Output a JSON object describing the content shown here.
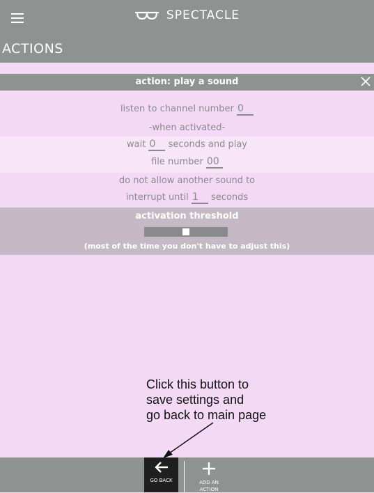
{
  "header": {
    "app_title": "SPECTACLE",
    "menu_icon": "hamburger-menu-icon",
    "logo_icon": "spectacles-logo-icon"
  },
  "section_title": "ACTIONS",
  "action": {
    "title": "action: play a sound",
    "close_icon": "close-icon",
    "channel_label": "listen to channel number",
    "channel_value": "0",
    "when_activated": "-when activated-",
    "wait_label": "wait",
    "wait_value": "0",
    "seconds_and_play": "seconds and play",
    "file_label": "file number",
    "file_value": "00",
    "no_interrupt_line1": "do not allow another sound to",
    "interrupt_until": "interrupt until",
    "interrupt_value": "1",
    "seconds": "seconds"
  },
  "threshold": {
    "label": "activation threshold",
    "level": 0.5,
    "hint": "(most of the time you don't have to adjust this)"
  },
  "annotation": {
    "text": "Click this button to\nsave settings and\ngo back to main page"
  },
  "bottom": {
    "back_label": "GO BACK",
    "back_icon": "arrow-left-icon",
    "add_label": "ADD AN ACTION",
    "add_icon": "plus-icon"
  },
  "colors": {
    "bar": "#8e9291",
    "page_bg": "#f3d9f6",
    "threshold_bg": "#c5b9c6",
    "back_button_bg": "#1f1f1f"
  }
}
